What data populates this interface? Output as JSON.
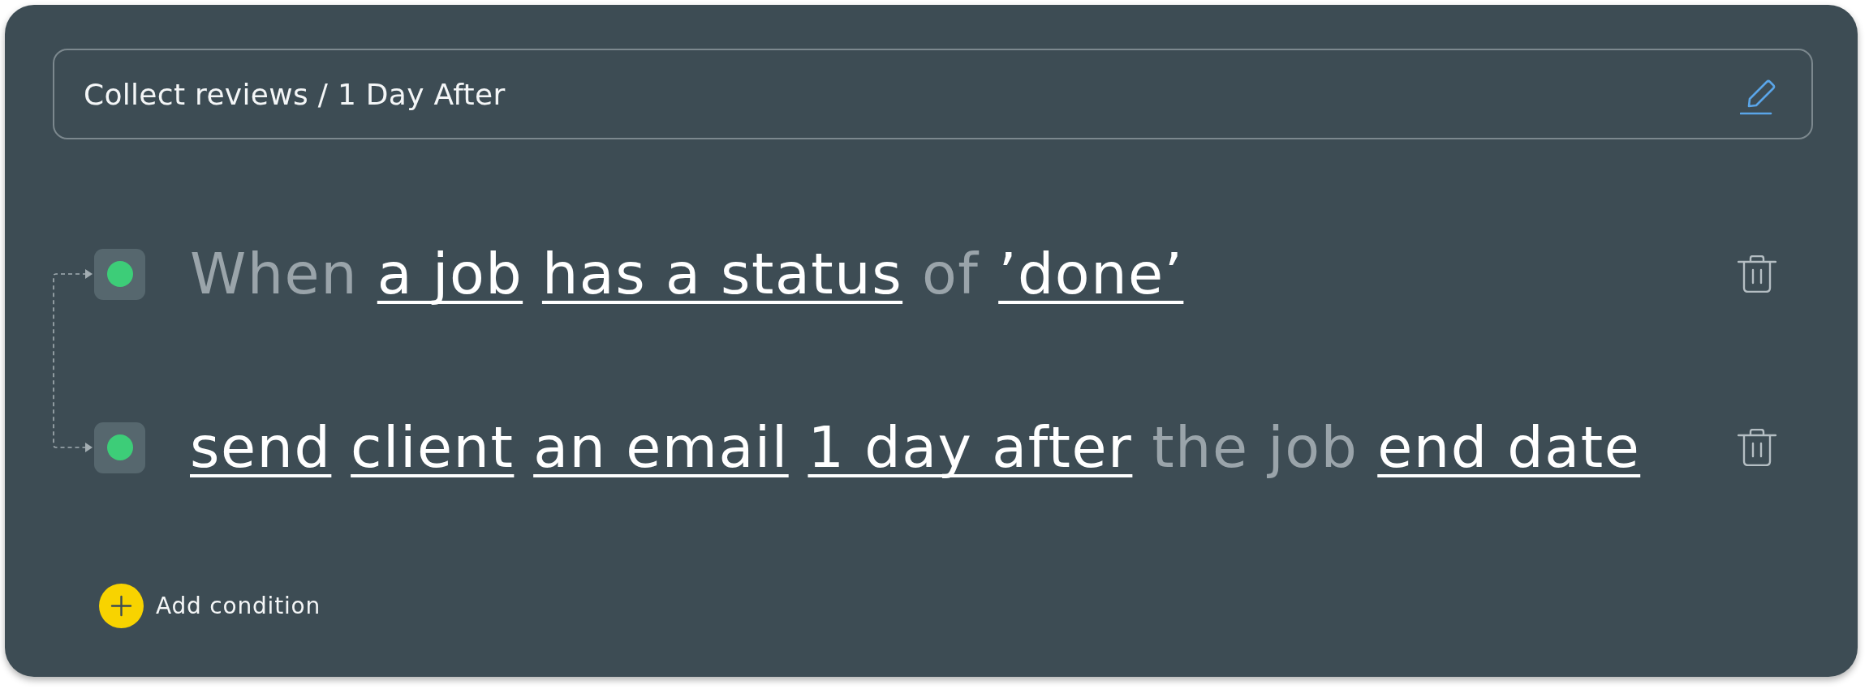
{
  "header": {
    "title": "Collect reviews / 1 Day After"
  },
  "rules": [
    {
      "active": true,
      "parts": [
        {
          "kind": "plain",
          "text": "When"
        },
        {
          "kind": "token",
          "text": "a job"
        },
        {
          "kind": "token",
          "text": "has a status"
        },
        {
          "kind": "plain",
          "text": "of"
        },
        {
          "kind": "token",
          "text": "’done’"
        }
      ]
    },
    {
      "active": true,
      "parts": [
        {
          "kind": "token",
          "text": "send"
        },
        {
          "kind": "token",
          "text": "client"
        },
        {
          "kind": "token",
          "text": "an email"
        },
        {
          "kind": "token",
          "text": "1 day after"
        },
        {
          "kind": "plain",
          "text": "the job"
        },
        {
          "kind": "token",
          "text": "end date"
        }
      ]
    }
  ],
  "add_button": {
    "label": "Add condition"
  }
}
